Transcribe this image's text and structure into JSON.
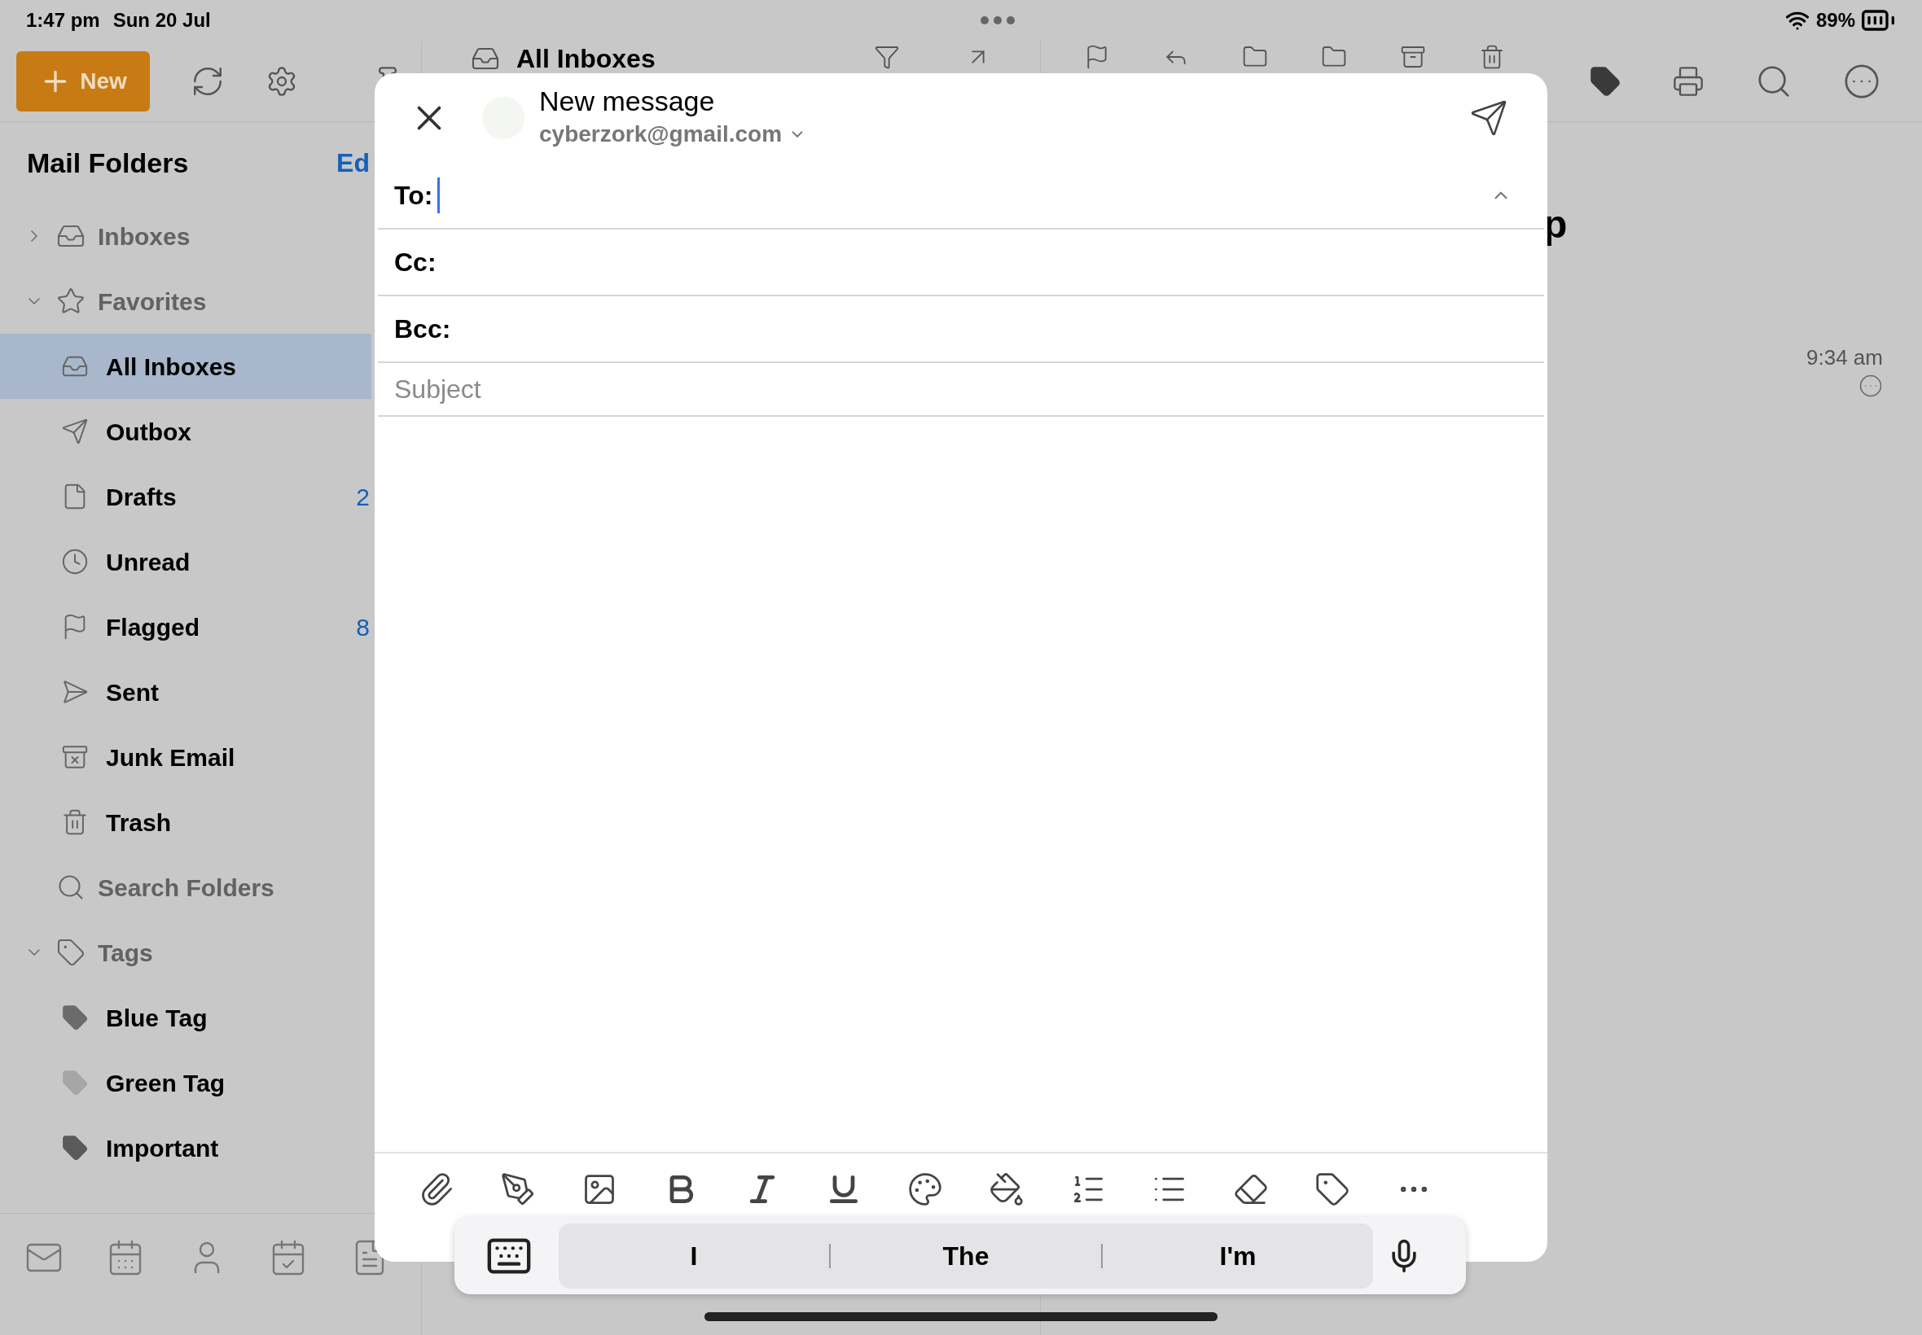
{
  "status_bar": {
    "time": "1:47 pm",
    "date": "Sun 20 Jul",
    "battery": "89%"
  },
  "toolbar": {
    "new_button": "New",
    "list_title": "All Inboxes"
  },
  "sidebar": {
    "title": "Mail Folders",
    "edit": "Ed",
    "groups": [
      {
        "label": "Inboxes",
        "kind": "group",
        "expanded": false
      },
      {
        "label": "Favorites",
        "kind": "group",
        "expanded": true,
        "children": [
          {
            "label": "All Inboxes",
            "selected": true
          },
          {
            "label": "Outbox",
            "selected": false
          },
          {
            "label": "Drafts",
            "selected": false,
            "count": "2"
          },
          {
            "label": "Unread",
            "selected": false
          },
          {
            "label": "Flagged",
            "selected": false,
            "count": "8"
          },
          {
            "label": "Sent",
            "selected": false
          },
          {
            "label": "Junk Email",
            "selected": false
          },
          {
            "label": "Trash",
            "selected": false
          }
        ]
      },
      {
        "label": "Search Folders",
        "kind": "search"
      },
      {
        "label": "Tags",
        "kind": "group",
        "expanded": true,
        "children": [
          {
            "label": "Blue Tag",
            "selected": false,
            "color": "#6b6b6b"
          },
          {
            "label": "Green Tag",
            "selected": false,
            "color": "#a6a6a6"
          },
          {
            "label": "Important",
            "selected": false,
            "color": "#5a5a5a"
          }
        ]
      }
    ]
  },
  "reading_pane": {
    "heading": "p",
    "time": "9:34 am"
  },
  "compose": {
    "title": "New message",
    "from": "cyberzork@gmail.com",
    "recipients_expanded": true,
    "fields": [
      {
        "label": "To:",
        "focused": true
      },
      {
        "label": "Cc:",
        "focused": false
      },
      {
        "label": "Bcc:",
        "focused": false
      }
    ],
    "subject": {
      "placeholder": "Subject"
    }
  },
  "suggestions": [
    "I",
    "The",
    "I'm"
  ]
}
